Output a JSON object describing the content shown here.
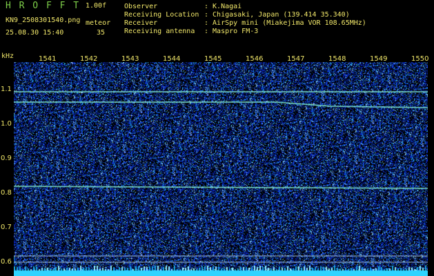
{
  "header": {
    "app_title": "H R O F F T",
    "version": "1.00f",
    "filename": "KN9_2508301540.png",
    "timestamp": "25.08.30 15:40",
    "meteor_label": "meteor",
    "meteor_count": "35",
    "fields": [
      {
        "label": "Observer",
        "value": ": K.Nagai"
      },
      {
        "label": "Receiving Location",
        "value": ": Chigasaki, Japan (139.414 35.340)"
      },
      {
        "label": "Receiver",
        "value": ": AirSpy mini (Miakejima VOR 108.65MHz)"
      },
      {
        "label": "Receiving antenna",
        "value": ": Maspro FM-3"
      }
    ]
  },
  "waterfall": {
    "y_unit": "kHz",
    "time_ticks": [
      "1541",
      "1542",
      "1543",
      "1544",
      "1545",
      "1546",
      "1547",
      "1548",
      "1549",
      "1550"
    ],
    "freq_ticks": [
      "1.1",
      "1.0",
      "0.9",
      "0.8",
      "0.7",
      "0.6"
    ],
    "colors": {
      "background": "#000",
      "label": "#f2e86a",
      "noise": "#1e3aa8",
      "signal": "#7fe8d0",
      "floor": "#2fd3ff"
    }
  }
}
